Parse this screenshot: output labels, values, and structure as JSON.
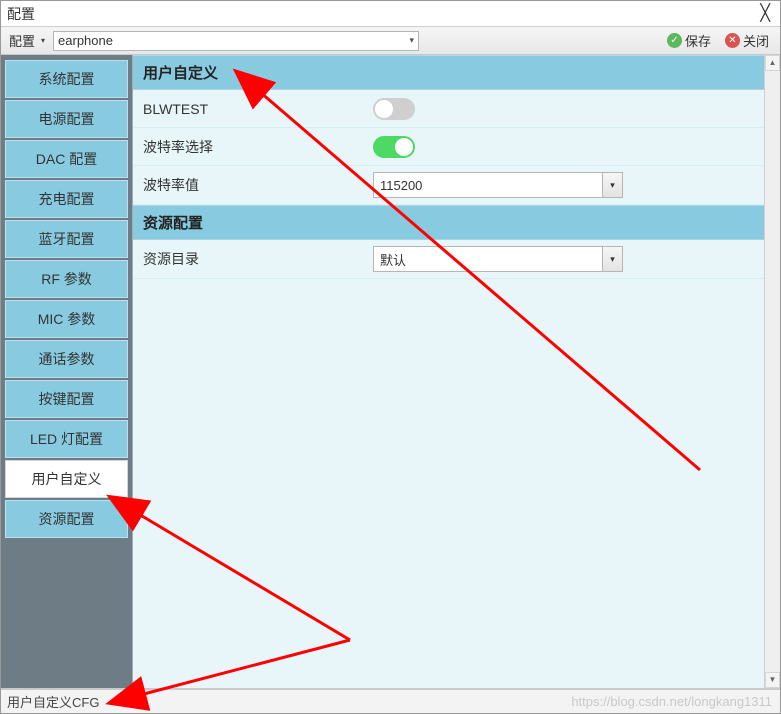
{
  "window": {
    "title": "配置",
    "close_glyph": "╳"
  },
  "toolbar": {
    "cfg_label": "配置",
    "device_value": "earphone",
    "save_label": "保存",
    "close_label": "关闭"
  },
  "sidebar": {
    "items": [
      {
        "label": "系统配置",
        "active": false
      },
      {
        "label": "电源配置",
        "active": false
      },
      {
        "label": "DAC 配置",
        "active": false
      },
      {
        "label": "充电配置",
        "active": false
      },
      {
        "label": "蓝牙配置",
        "active": false
      },
      {
        "label": "RF 参数",
        "active": false
      },
      {
        "label": "MIC 参数",
        "active": false
      },
      {
        "label": "通话参数",
        "active": false
      },
      {
        "label": "按键配置",
        "active": false
      },
      {
        "label": "LED 灯配置",
        "active": false
      },
      {
        "label": "用户自定义",
        "active": true
      },
      {
        "label": "资源配置",
        "active": false
      }
    ]
  },
  "sections": {
    "user_custom_header": "用户自定义",
    "resource_cfg_header": "资源配置"
  },
  "rows": {
    "blwtest": {
      "label": "BLWTEST",
      "value": false
    },
    "baud_enable": {
      "label": "波特率选择",
      "value": true
    },
    "baud_value_label": "波特率值",
    "baud_value": "115200",
    "resource_dir_label": "资源目录",
    "resource_dir_value": "默认"
  },
  "statusbar": {
    "text": "用户自定义CFG"
  },
  "watermark": "https://blog.csdn.net/longkang1311"
}
